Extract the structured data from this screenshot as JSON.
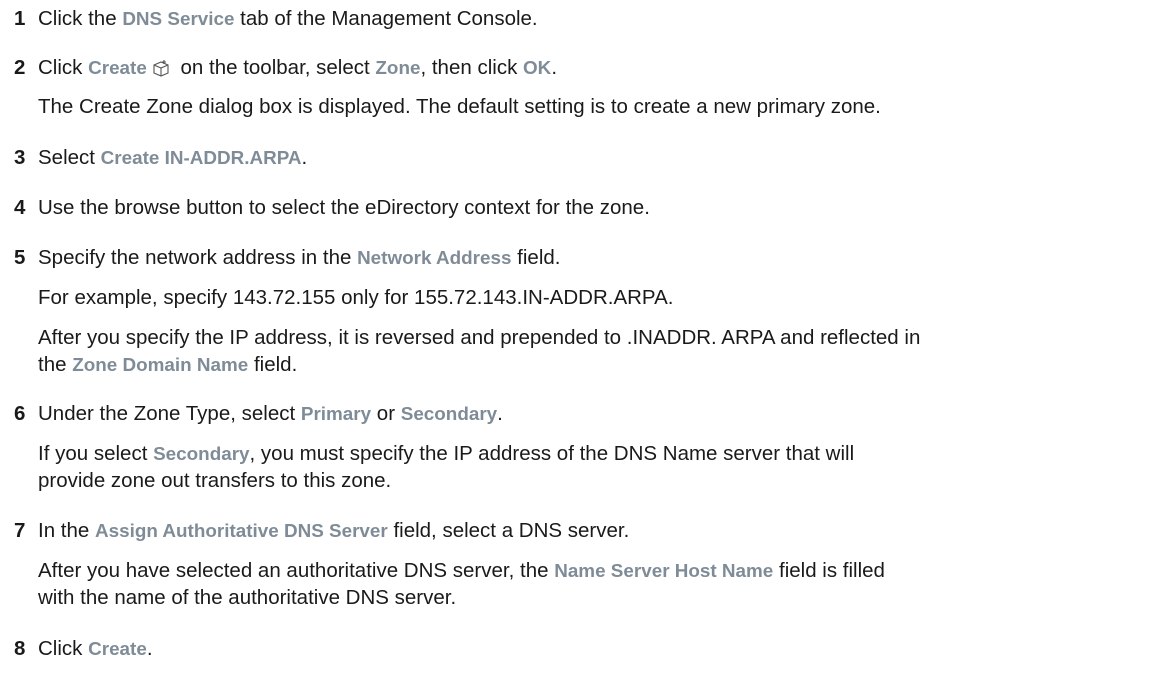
{
  "steps": [
    {
      "num": "1",
      "t0": "Click the ",
      "u0": "DNS Service",
      "t1": " tab of the Management Console."
    },
    {
      "num": "2",
      "t0": "Click ",
      "u0": "Create",
      "icon": "create-cube-icon",
      "t1": " on the toolbar, select ",
      "u1": "Zone",
      "t2": ", then click ",
      "u2": "OK",
      "t3": ".",
      "note": "The Create Zone dialog box is displayed. The default setting is to create a new primary zone."
    },
    {
      "num": "3",
      "t0": "Select ",
      "u0": "Create IN-ADDR.ARPA",
      "t1": "."
    },
    {
      "num": "4",
      "t0": "Use the browse button to select the eDirectory context for the zone."
    },
    {
      "num": "5",
      "t0": "Specify the network address in the ",
      "u0": "Network Address",
      "t1": " field.",
      "note1": "For example, specify 143.72.155 only for 155.72.143.IN-ADDR.ARPA.",
      "note2a": "After you specify the IP address, it is reversed and prepended to .INADDR. ARPA and reflected in",
      "note2b_t0": "the ",
      "note2b_u0": "Zone Domain Name",
      "note2b_t1": " field."
    },
    {
      "num": "6",
      "t0": "Under the Zone Type, select ",
      "u0": "Primary",
      "t1": " or ",
      "u1": "Secondary",
      "t2": ".",
      "note_a_t0": "If you select ",
      "note_a_u0": "Secondary",
      "note_a_t1": ", you must specify the IP address of the DNS Name server that will",
      "note_b": "provide zone out transfers to this zone."
    },
    {
      "num": "7",
      "t0": "In the ",
      "u0": "Assign Authoritative DNS Server",
      "t1": " field, select a DNS server.",
      "note_a_t0": "After you have selected an authoritative DNS server, the ",
      "note_a_u0": "Name Server Host Name",
      "note_a_t1": " field is filled",
      "note_b": "with the name of the authoritative DNS server."
    },
    {
      "num": "8",
      "t0": "Click ",
      "u0": "Create",
      "t1": "."
    }
  ]
}
